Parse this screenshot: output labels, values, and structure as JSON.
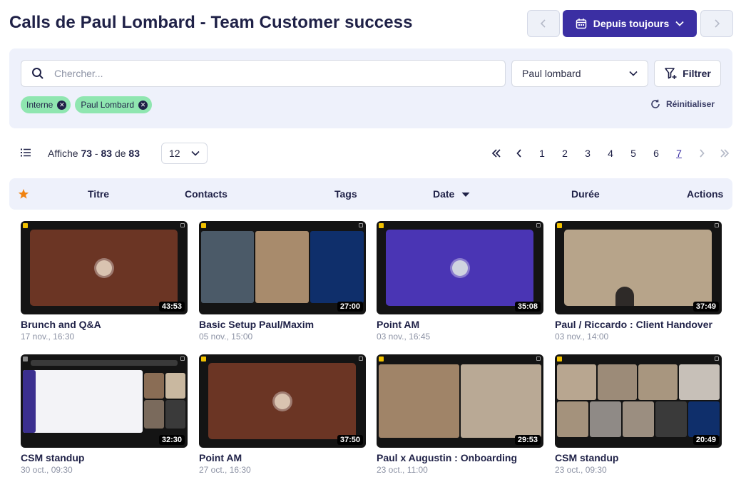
{
  "header": {
    "title": "Calls de Paul Lombard - Team Customer success",
    "date_range_label": "Depuis toujours"
  },
  "filters": {
    "search_placeholder": "Chercher...",
    "search_value": "",
    "user_select_value": "Paul lombard",
    "filter_button_label": "Filtrer",
    "reset_label": "Réinitialiser",
    "chips": [
      "Interne",
      "Paul Lombard"
    ]
  },
  "listing": {
    "showing_prefix": "Affiche",
    "range_start": "73",
    "range_sep": "-",
    "range_end": "83",
    "of_label": "de",
    "total": "83",
    "per_page": "12"
  },
  "pagination": {
    "pages": [
      "1",
      "2",
      "3",
      "4",
      "5",
      "6",
      "7"
    ],
    "current": "7"
  },
  "table_head": {
    "title": "Titre",
    "contacts": "Contacts",
    "tags": "Tags",
    "date": "Date",
    "duration": "Durée",
    "actions": "Actions"
  },
  "calls": [
    {
      "title": "Brunch and Q&A",
      "date": "17 nov., 16:30",
      "duration": "43:53"
    },
    {
      "title": "Basic Setup Paul/Maxim",
      "date": "05 nov., 15:00",
      "duration": "27:00"
    },
    {
      "title": "Point AM",
      "date": "03 nov., 16:45",
      "duration": "35:08"
    },
    {
      "title": "Paul / Riccardo : Client Handover",
      "date": "03 nov., 14:00",
      "duration": "37:49"
    },
    {
      "title": "CSM standup",
      "date": "30 oct., 09:30",
      "duration": "32:30"
    },
    {
      "title": "Point AM",
      "date": "27 oct., 16:30",
      "duration": "37:50"
    },
    {
      "title": "Paul x Augustin : Onboarding",
      "date": "23 oct., 11:00",
      "duration": "29:53"
    },
    {
      "title": "CSM standup",
      "date": "23 oct., 09:30",
      "duration": "20:49"
    }
  ],
  "colors": {
    "brand": "#3b2fa3",
    "panel": "#eef1fb",
    "chip": "#8fe6b0",
    "star": "#f0820f"
  }
}
